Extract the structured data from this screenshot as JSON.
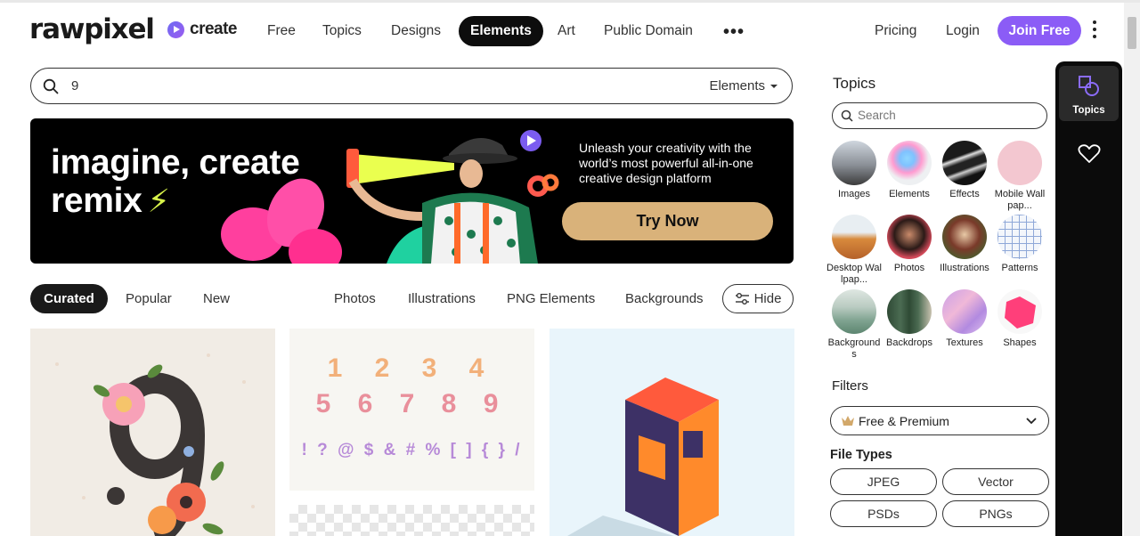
{
  "header": {
    "logo": "rawpixel",
    "create_label": "create",
    "nav": [
      {
        "label": "Free"
      },
      {
        "label": "Topics"
      },
      {
        "label": "Designs"
      },
      {
        "label": "Elements",
        "active": true
      },
      {
        "label": "Art"
      },
      {
        "label": "Public Domain"
      }
    ],
    "more_label": "•••",
    "pricing_label": "Pricing",
    "login_label": "Login",
    "join_label": "Join Free"
  },
  "search": {
    "value": "9",
    "type_label": "Elements"
  },
  "banner": {
    "headline_line1": "imagine, create",
    "headline_line2": "remix",
    "text": "Unleash your creativity with the world’s most powerful all-in-one creative design platform",
    "cta_label": "Try Now"
  },
  "sort_tabs": {
    "curated": "Curated",
    "popular": "Popular",
    "new": "New"
  },
  "category_links": [
    "Photos",
    "Illustrations",
    "PNG Elements",
    "Backgrounds"
  ],
  "hide_label": "Hide",
  "results_card_text": {
    "numbers_row1": "1 2 3 4",
    "numbers_row2": "5 6 7 8 9",
    "symbols": "! ? @ $ & # % [ ] { } /"
  },
  "side_panel": {
    "title": "Topics",
    "search_placeholder": "Search",
    "topics": [
      {
        "label": "Images"
      },
      {
        "label": "Elements"
      },
      {
        "label": "Effects"
      },
      {
        "label": "Mobile Wallpap..."
      },
      {
        "label": "Desktop Wallpap..."
      },
      {
        "label": "Photos"
      },
      {
        "label": "Illustrations"
      },
      {
        "label": "Patterns"
      },
      {
        "label": "Backgrounds"
      },
      {
        "label": "Backdrops"
      },
      {
        "label": "Textures"
      },
      {
        "label": "Shapes"
      }
    ],
    "filters_title": "Filters",
    "filter_select": "Free & Premium",
    "file_types_title": "File Types",
    "file_types": [
      "JPEG",
      "Vector",
      "PSDs",
      "PNGs"
    ]
  },
  "rail": {
    "topics_label": "Topics"
  },
  "colors": {
    "accent": "#8b5cf6",
    "banner_cta": "#d9b27a",
    "dark": "#0d0d0d"
  }
}
